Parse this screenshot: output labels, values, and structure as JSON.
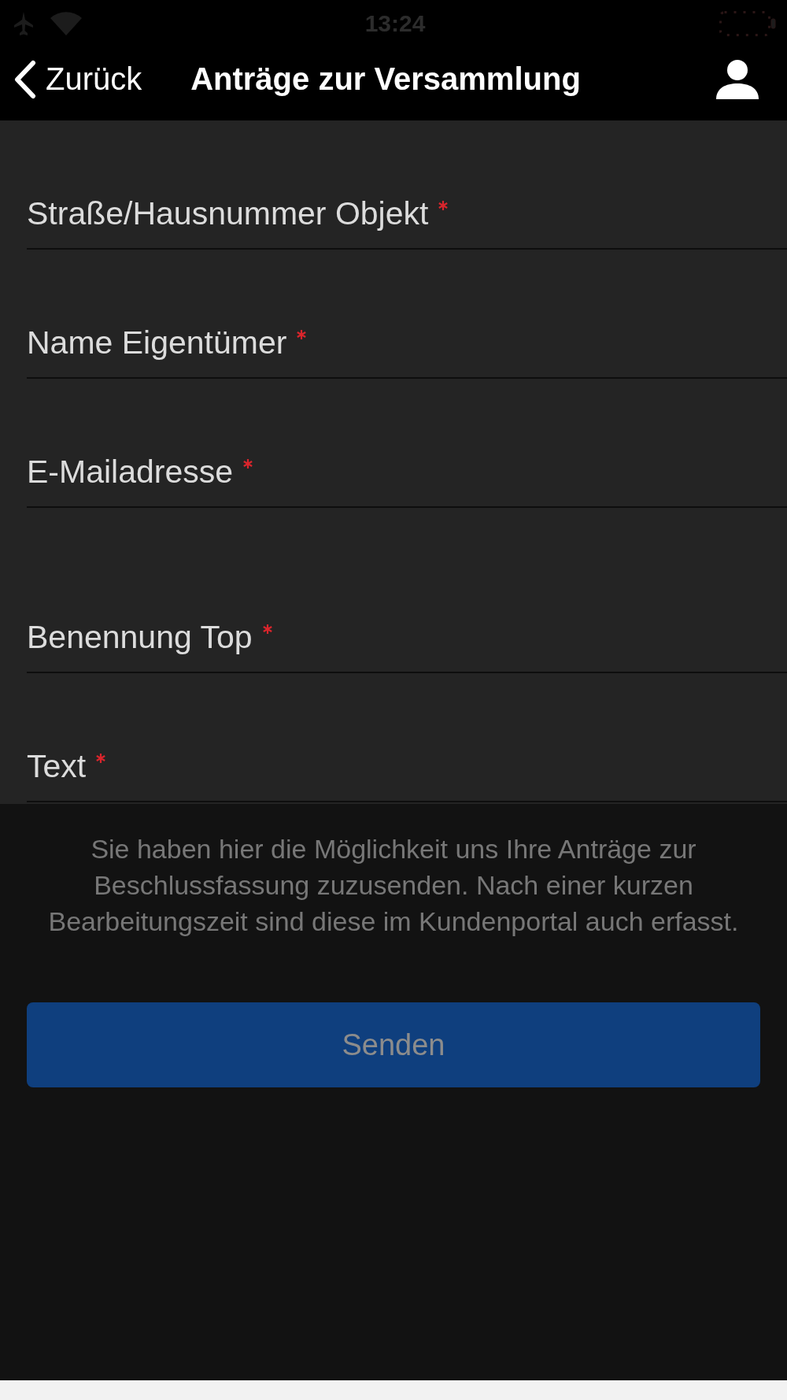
{
  "status_bar": {
    "time": "13:24"
  },
  "nav_bar": {
    "back_label": "Zurück",
    "title": "Anträge zur Versammlung"
  },
  "form": {
    "groups": [
      {
        "fields": [
          {
            "label": "Straße/Hausnummer Objekt",
            "required": true
          },
          {
            "label": "Name Eigentümer",
            "required": true
          },
          {
            "label": "E-Mailadresse",
            "required": true
          }
        ]
      },
      {
        "fields": [
          {
            "label": "Benennung Top",
            "required": true
          },
          {
            "label": "Text",
            "required": true
          }
        ]
      }
    ]
  },
  "info_text": "Sie haben hier die Möglichkeit uns Ihre Anträge zur Beschlussfassung zuzusenden. Nach einer kurzen Bearbeitungszeit sind diese im Kundenportal auch erfasst.",
  "submit_button": {
    "label": "Senden",
    "disabled": true
  }
}
